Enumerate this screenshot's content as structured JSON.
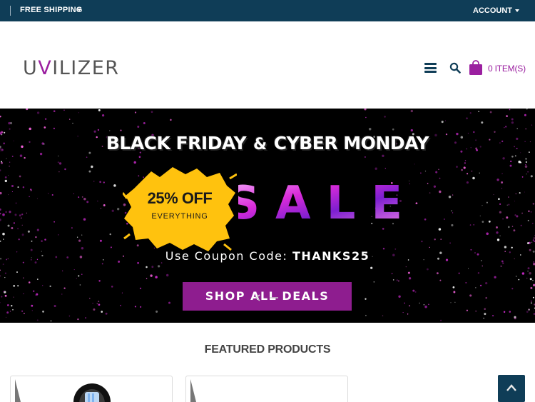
{
  "topbar": {
    "shipping_label": "FREE SHIPPING",
    "account_label": "ACCOUNT"
  },
  "header": {
    "logo_u": "U",
    "logo_v": "V",
    "logo_rest": "ILIZER",
    "cart_label": "0 ITEM(S)"
  },
  "banner": {
    "headline_left": "BLACK FRIDAY",
    "headline_amp": "&",
    "headline_right": "CYBER MONDAY",
    "discount": "25% OFF",
    "discount_sub": "EVERYTHING",
    "sale_word": "SALE",
    "coupon_prefix": "Use Coupon Code: ",
    "coupon_code": "THANKS25",
    "cta_label": "SHOP ALL DEALS"
  },
  "featured": {
    "title": "FEATURED PRODUCTS"
  },
  "colors": {
    "topbar_bg": "#0f3d57",
    "brand_purple": "#9b1fa0",
    "cta_purple": "#8e1d8f",
    "splash_yellow": "#ffc20e"
  },
  "icons": [
    "caret-down-icon",
    "hamburger-menu-icon",
    "search-icon",
    "shopping-bag-icon",
    "chevron-up-icon"
  ]
}
